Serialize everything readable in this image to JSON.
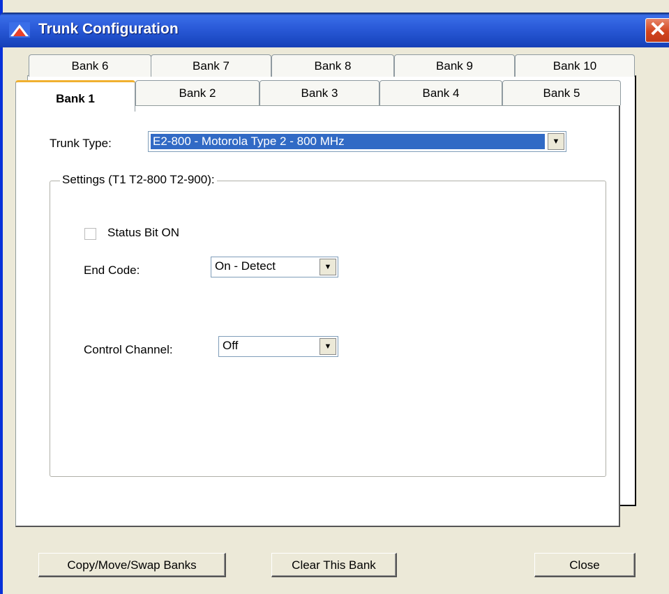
{
  "window": {
    "title": "Trunk Configuration",
    "close_glyph": "✕"
  },
  "tabs": {
    "back_row": [
      "Bank 6",
      "Bank 7",
      "Bank 8",
      "Bank 9",
      "Bank 10"
    ],
    "front_row": [
      "Bank 1",
      "Bank 2",
      "Bank 3",
      "Bank 4",
      "Bank 5"
    ],
    "active": "Bank 1"
  },
  "trunk_type": {
    "label": "Trunk Type:",
    "value": "E2-800 - Motorola Type 2 - 800 MHz"
  },
  "settings": {
    "legend": "Settings (T1 T2-800 T2-900):",
    "status_bit": {
      "label": "Status Bit ON",
      "checked": false
    },
    "end_code": {
      "label": "End Code:",
      "value": "On - Detect"
    },
    "control_channel": {
      "label": "Control Channel:",
      "value": "Off"
    }
  },
  "buttons": {
    "copy_move_swap": "Copy/Move/Swap Banks",
    "clear_bank": "Clear This Bank",
    "close": "Close"
  },
  "icons": {
    "app": "triangle-app-icon",
    "dropdown": "chevron-down-icon"
  },
  "colors": {
    "titlebar": "#2a5ad8",
    "selection": "#316ac5",
    "active_tab_accent": "#f0b030",
    "close_button": "#d2451e"
  }
}
